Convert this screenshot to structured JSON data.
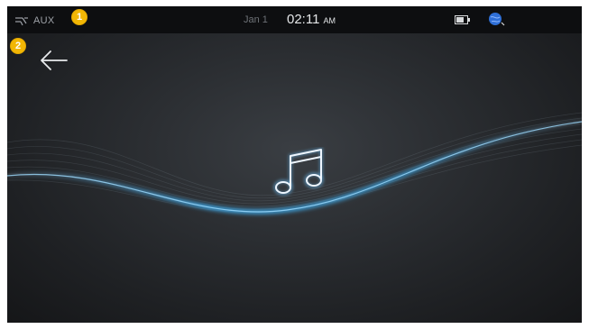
{
  "status_bar": {
    "source_label": "AUX",
    "date": "Jan 1",
    "time": "02:11",
    "ampm": "AM"
  },
  "callouts": {
    "one": "1",
    "two": "2"
  },
  "icons": {
    "source": "aux-source-icon",
    "battery": "battery-icon",
    "globe": "globe-icon",
    "back": "back-arrow-icon",
    "music": "music-note-icon"
  },
  "colors": {
    "badge": "#f2b705",
    "wave_glow": "#3fb8ff",
    "icon_glow": "#cfe6ff",
    "globe": "#2f6fd6"
  }
}
